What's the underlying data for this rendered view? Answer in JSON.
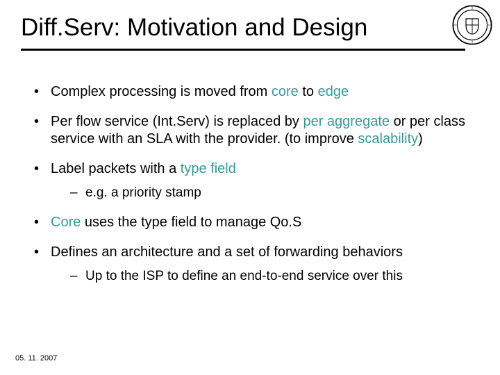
{
  "title": "Diff.Serv: Motivation and Design",
  "bullets": {
    "b1_a": "Complex processing is moved from ",
    "b1_hl1": "core",
    "b1_b": " to ",
    "b1_hl2": "edge",
    "b2_a": "Per flow service (Int.Serv) is replaced by ",
    "b2_hl1": "per aggregate",
    "b2_b": " or per class service with an SLA with the provider. (to improve ",
    "b2_hl2": "scalability",
    "b2_c": ")",
    "b3_a": "Label packets with a ",
    "b3_hl1": "type field",
    "b3_sub1": "e.g. a priority stamp",
    "b4_hl1": "Core",
    "b4_a": " uses the type field to manage Qo.S",
    "b5_a": "Defines an architecture and a set of forwarding behaviors",
    "b5_sub1": "Up to the ISP to define an end-to-end service over this"
  },
  "footer_date": "05. 11. 2007",
  "logo_name": "university-crest-icon"
}
